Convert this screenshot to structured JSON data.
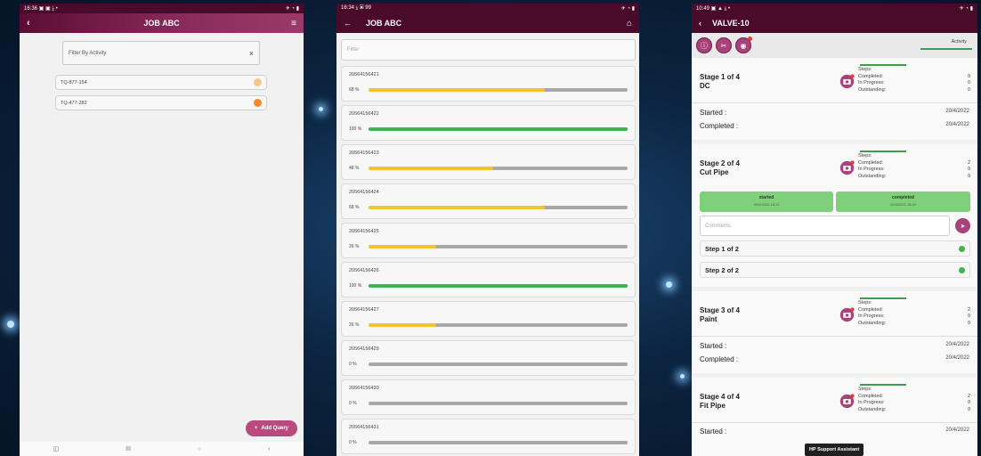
{
  "phone1": {
    "status_time": "16:36 ▣ ▣ ⤓ •",
    "status_right": "✈ ◔ ▮",
    "back_icon": "‹",
    "title": "JOB ABC",
    "filter_icon": "≡",
    "filter_label": "Filter By Activity",
    "clear_icon": "×",
    "items": [
      {
        "label": "TQ-877-154",
        "dot_color": "#f3c98a"
      },
      {
        "label": "TQ-477-282",
        "dot_color": "#f28a2a"
      }
    ],
    "fab_icon": "+",
    "fab_label": "Add Query",
    "nav": [
      "◫",
      "III",
      "○",
      "‹"
    ]
  },
  "phone2": {
    "status_time": "16:34 ⤓ ▣ 99",
    "status_right": "✈ ◔ ▮",
    "back_icon": "←",
    "title": "JOB ABC",
    "home_icon": "⌂",
    "filter_placeholder": "Filter",
    "rows": [
      {
        "id": "20564156421",
        "pct": "68 %",
        "progress": 0.68,
        "color": "#f4c430"
      },
      {
        "id": "20564156422",
        "pct": "100 %",
        "progress": 1.0,
        "color": "#43b24a"
      },
      {
        "id": "20564156423",
        "pct": "48 %",
        "progress": 0.48,
        "color": "#f4c430"
      },
      {
        "id": "20564156424",
        "pct": "68 %",
        "progress": 0.68,
        "color": "#f4c430"
      },
      {
        "id": "20564156425",
        "pct": "26 %",
        "progress": 0.26,
        "color": "#f4c430"
      },
      {
        "id": "20564156426",
        "pct": "100 %",
        "progress": 1.0,
        "color": "#43b24a"
      },
      {
        "id": "20564156427",
        "pct": "26 %",
        "progress": 0.26,
        "color": "#f4c430"
      },
      {
        "id": "20564156429",
        "pct": "0 %",
        "progress": 0,
        "color": "#f4c430"
      },
      {
        "id": "20564156430",
        "pct": "0 %",
        "progress": 0,
        "color": "#f4c430"
      },
      {
        "id": "20564156431",
        "pct": "0 %",
        "progress": 0,
        "color": "#f4c430"
      }
    ]
  },
  "phone3": {
    "status_time": "10:49 ▣ ▲ ⤓ •",
    "status_right": "✈ ◔ ▮",
    "back_icon": "‹",
    "title": "VALVE-10",
    "tab_icons": [
      "ⓘ",
      "✂",
      "◉"
    ],
    "activity_label": "Activity",
    "steps_labels": {
      "steps": "Steps:",
      "completed": "Completed:",
      "in_progress": "In Progress:",
      "outstanding": "Outstanding:"
    },
    "started_label": "Started :",
    "completed_label": "Completed :",
    "stage1": {
      "title1": "Stage 1 of 4",
      "title2": "DC",
      "completed": "0",
      "in_progress": "0",
      "outstanding": "0",
      "started": "20/4/2022",
      "completed_date": "20/4/2022"
    },
    "stage2": {
      "title1": "Stage 2 of 4",
      "title2": "Cut Pipe",
      "completed": "2",
      "in_progress": "0",
      "outstanding": "0",
      "btn_started": "started",
      "btn_started_sub": "20/4/2022 15:11",
      "btn_completed": "completed",
      "btn_completed_sub": "20/4/2022 15:44",
      "comments_placeholder": "Comments",
      "send_icon": "➤",
      "step1": "Step 1 of 2",
      "step2": "Step 2 of 2"
    },
    "stage3": {
      "title1": "Stage 3 of 4",
      "title2": "Paint",
      "completed": "2",
      "in_progress": "0",
      "outstanding": "0",
      "started": "20/4/2022",
      "completed_date": "20/4/2022"
    },
    "stage4": {
      "title1": "Stage 4 of 4",
      "title2": "Fit Pipe",
      "completed": "2",
      "in_progress": "0",
      "outstanding": "0",
      "started": "20/4/2022"
    },
    "tooltip": "HP Support Assistant"
  },
  "colors": {
    "appbar": "#6b1540",
    "accent": "#a8427a",
    "green": "#43b24a",
    "yellow": "#f4c430"
  }
}
